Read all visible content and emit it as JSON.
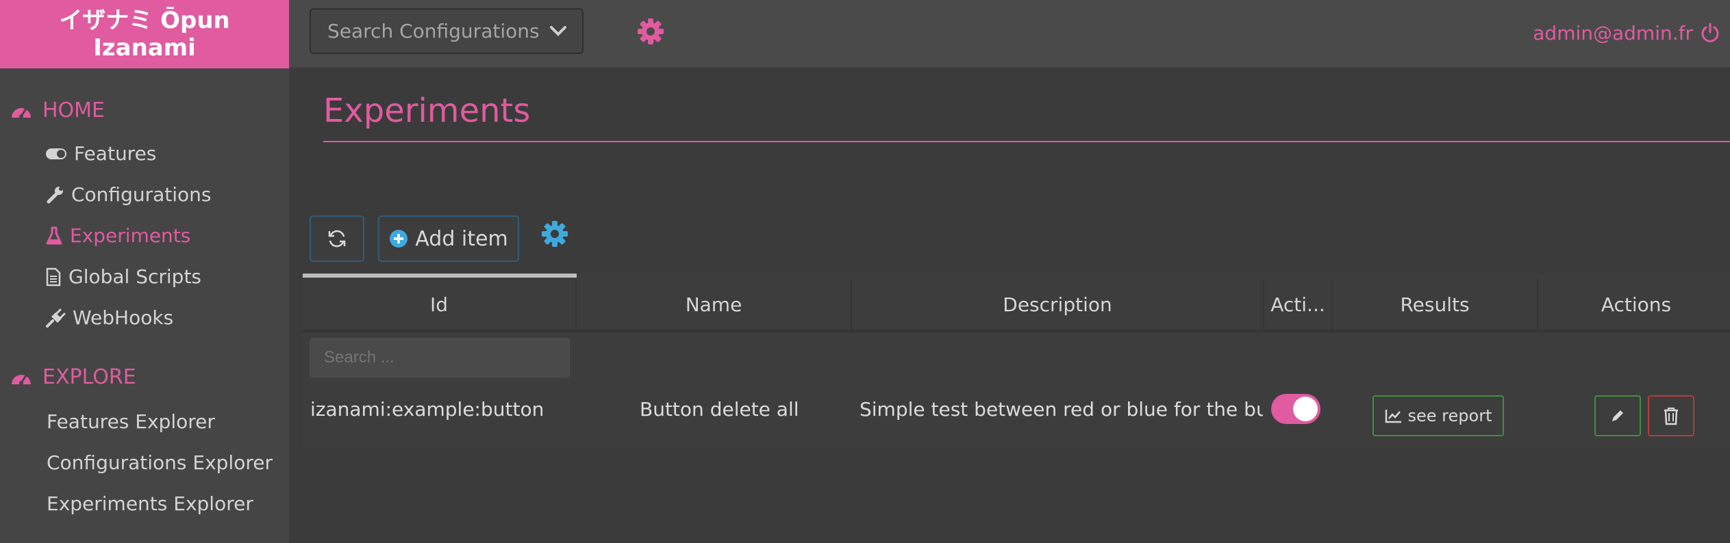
{
  "brand": {
    "line1": "イザナミ Ōpun",
    "line2": "Izanami"
  },
  "search": {
    "placeholder": "Search Configurations"
  },
  "user": {
    "email": "admin@admin.fr"
  },
  "sidebar": {
    "home": {
      "label": "HOME",
      "items": [
        {
          "label": "Features",
          "icon": "toggle-icon"
        },
        {
          "label": "Configurations",
          "icon": "wrench-icon"
        },
        {
          "label": "Experiments",
          "icon": "flask-icon",
          "active": true
        },
        {
          "label": "Global Scripts",
          "icon": "file-icon"
        },
        {
          "label": "WebHooks",
          "icon": "plug-icon"
        }
      ]
    },
    "explore": {
      "label": "EXPLORE",
      "items": [
        {
          "label": "Features Explorer"
        },
        {
          "label": "Configurations Explorer"
        },
        {
          "label": "Experiments Explorer"
        }
      ]
    }
  },
  "page": {
    "title": "Experiments"
  },
  "toolbar": {
    "add_label": "Add item"
  },
  "table": {
    "columns": [
      "Id",
      "Name",
      "Description",
      "Acti...",
      "Results",
      "Actions"
    ],
    "filter_placeholder": "Search ...",
    "rows": [
      {
        "id": "izanami:example:button",
        "name": "Button delete all",
        "description": "Simple test between red or blue for the butto",
        "active": true,
        "results_label": "see report"
      }
    ]
  },
  "colors": {
    "accent": "#e05ba0",
    "toolbar_border": "#2e5d7a",
    "info_icon": "#3fa9dd",
    "success": "#3f8f3f",
    "danger": "#b53c3c"
  }
}
